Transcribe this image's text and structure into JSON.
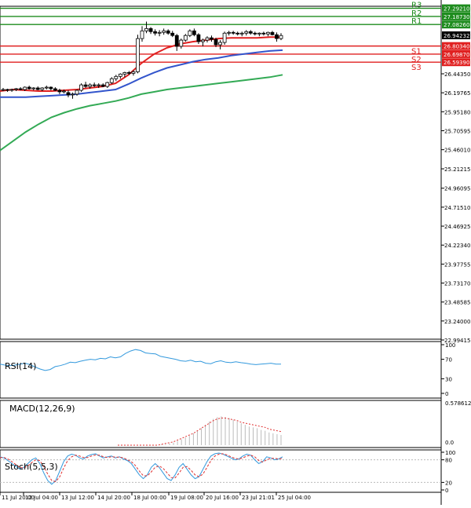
{
  "chart_data": [
    {
      "type": "candlestick",
      "panel": "price",
      "ylim": [
        22.99415,
        27.4
      ],
      "price_ticks": [
        "26.44350",
        "26.19765",
        "25.95180",
        "25.70595",
        "25.46010",
        "25.21215",
        "24.96095",
        "24.71510",
        "24.46925",
        "24.22340",
        "23.97755",
        "23.73170",
        "23.48585",
        "23.24000",
        "22.99415"
      ],
      "levels": [
        {
          "name": "R3",
          "value": 27.2921,
          "label": "27.29210",
          "color": "#1e8c1e"
        },
        {
          "name": "R2",
          "value": 27.1873,
          "label": "27.18730",
          "color": "#1e8c1e"
        },
        {
          "name": "R1",
          "value": 27.0826,
          "label": "27.08260",
          "color": "#1e8c1e"
        },
        {
          "name": "S1",
          "value": 26.8034,
          "label": "26.80340",
          "color": "#e02020"
        },
        {
          "name": "S2",
          "value": 26.6987,
          "label": "26.69870",
          "color": "#e02020"
        },
        {
          "name": "S3",
          "value": 26.5939,
          "label": "26.59390",
          "color": "#e02020"
        }
      ],
      "current_price": {
        "value": 26.94232,
        "label": "26.94232"
      },
      "candles": [
        [
          26.24,
          26.26,
          26.22,
          26.24
        ],
        [
          26.24,
          26.25,
          26.21,
          26.23
        ],
        [
          26.23,
          26.25,
          26.21,
          26.24
        ],
        [
          26.24,
          26.26,
          26.22,
          26.25
        ],
        [
          26.25,
          26.27,
          26.23,
          26.24
        ],
        [
          26.24,
          26.28,
          26.22,
          26.27
        ],
        [
          26.27,
          26.29,
          26.24,
          26.25
        ],
        [
          26.25,
          26.27,
          26.23,
          26.26
        ],
        [
          26.26,
          26.28,
          26.23,
          26.24
        ],
        [
          26.24,
          26.27,
          26.22,
          26.26
        ],
        [
          26.26,
          26.29,
          26.24,
          26.27
        ],
        [
          26.27,
          26.28,
          26.23,
          26.25
        ],
        [
          26.25,
          26.27,
          26.22,
          26.23
        ],
        [
          26.23,
          26.25,
          26.18,
          26.21
        ],
        [
          26.21,
          26.24,
          26.19,
          26.22
        ],
        [
          26.2,
          26.23,
          26.14,
          26.17
        ],
        [
          26.17,
          26.2,
          26.12,
          26.18
        ],
        [
          26.18,
          26.24,
          26.16,
          26.23
        ],
        [
          26.23,
          26.32,
          26.21,
          26.3
        ],
        [
          26.3,
          26.34,
          26.26,
          26.28
        ],
        [
          26.28,
          26.32,
          26.25,
          26.3
        ],
        [
          26.3,
          26.33,
          26.27,
          26.29
        ],
        [
          26.29,
          26.32,
          26.26,
          26.3
        ],
        [
          26.3,
          26.32,
          26.27,
          26.28
        ],
        [
          26.28,
          26.34,
          26.26,
          26.33
        ],
        [
          26.33,
          26.4,
          26.31,
          26.38
        ],
        [
          26.38,
          26.43,
          26.35,
          26.41
        ],
        [
          26.41,
          26.45,
          26.38,
          26.44
        ],
        [
          26.44,
          26.47,
          26.4,
          26.46
        ],
        [
          26.46,
          26.48,
          26.43,
          26.45
        ],
        [
          26.45,
          26.49,
          26.42,
          26.47
        ],
        [
          26.47,
          26.95,
          26.45,
          26.9
        ],
        [
          26.9,
          27.06,
          26.86,
          27.0
        ],
        [
          27.0,
          27.12,
          26.97,
          27.03
        ],
        [
          27.03,
          27.05,
          26.96,
          26.99
        ],
        [
          26.99,
          27.02,
          26.94,
          26.97
        ],
        [
          26.97,
          27.01,
          26.93,
          26.98
        ],
        [
          26.98,
          27.03,
          26.95,
          27.0
        ],
        [
          27.0,
          27.02,
          26.95,
          26.97
        ],
        [
          26.97,
          27.0,
          26.92,
          26.94
        ],
        [
          26.94,
          26.96,
          26.74,
          26.8
        ],
        [
          26.8,
          26.9,
          26.77,
          26.88
        ],
        [
          26.88,
          26.96,
          26.86,
          26.94
        ],
        [
          26.94,
          27.02,
          26.92,
          27.0
        ],
        [
          27.0,
          27.03,
          26.93,
          26.95
        ],
        [
          26.95,
          26.97,
          26.83,
          26.86
        ],
        [
          26.86,
          26.9,
          26.8,
          26.88
        ],
        [
          26.88,
          26.93,
          26.85,
          26.91
        ],
        [
          26.91,
          26.94,
          26.86,
          26.89
        ],
        [
          26.89,
          26.91,
          26.79,
          26.82
        ],
        [
          26.82,
          26.88,
          26.76,
          26.85
        ],
        [
          26.85,
          26.99,
          26.82,
          26.97
        ],
        [
          26.97,
          27.0,
          26.94,
          26.98
        ],
        [
          26.98,
          27.0,
          26.95,
          26.97
        ],
        [
          26.97,
          26.99,
          26.94,
          26.96
        ],
        [
          26.96,
          26.99,
          26.93,
          26.97
        ],
        [
          26.97,
          27.01,
          26.94,
          26.99
        ],
        [
          26.99,
          27.01,
          26.95,
          26.97
        ],
        [
          26.97,
          26.99,
          26.94,
          26.96
        ],
        [
          26.96,
          26.98,
          26.93,
          26.97
        ],
        [
          26.97,
          26.99,
          26.94,
          26.96
        ],
        [
          26.96,
          26.99,
          26.93,
          26.98
        ],
        [
          26.98,
          27.0,
          26.94,
          26.95
        ],
        [
          26.95,
          26.98,
          26.86,
          26.9
        ],
        [
          26.9,
          26.97,
          26.88,
          26.94
        ]
      ],
      "moving_averages": [
        {
          "color": "#e02020",
          "values": [
            26.22,
            26.24,
            26.23,
            26.22,
            26.22,
            26.23,
            26.24,
            26.26,
            26.28,
            26.32,
            26.43,
            26.58,
            26.7,
            26.78,
            26.83,
            26.86,
            26.88,
            26.9,
            26.91,
            26.91,
            26.91,
            26.92,
            26.92
          ]
        },
        {
          "color": "#3355cc",
          "values": [
            26.14,
            26.14,
            26.14,
            26.15,
            26.16,
            26.17,
            26.18,
            26.2,
            26.22,
            26.24,
            26.31,
            26.39,
            26.46,
            26.52,
            26.56,
            26.6,
            26.63,
            26.65,
            26.68,
            26.7,
            26.72,
            26.74,
            26.75
          ]
        },
        {
          "color": "#33aa55",
          "values": [
            25.45,
            25.57,
            25.69,
            25.79,
            25.88,
            25.94,
            25.99,
            26.03,
            26.06,
            26.09,
            26.13,
            26.18,
            26.21,
            26.24,
            26.26,
            26.28,
            26.3,
            26.32,
            26.34,
            26.36,
            26.38,
            26.4,
            26.43
          ]
        }
      ]
    },
    {
      "type": "line",
      "panel": "rsi",
      "title": "RSI(14)",
      "ylim": [
        0,
        100
      ],
      "yticks": [
        "100",
        "70",
        "30",
        "0"
      ],
      "values": [
        60,
        58,
        57,
        58,
        60,
        62,
        59,
        54,
        50,
        47,
        49,
        55,
        57,
        60,
        64,
        63,
        66,
        68,
        70,
        69,
        72,
        71,
        75,
        73,
        75,
        82,
        87,
        90,
        88,
        83,
        82,
        81,
        76,
        74,
        72,
        70,
        67,
        66,
        68,
        65,
        66,
        62,
        61,
        65,
        67,
        64,
        63,
        65,
        63,
        62,
        60,
        59,
        60,
        61,
        62,
        60,
        60
      ]
    },
    {
      "type": "bar",
      "panel": "macd",
      "title": "MACD(12,26,9)",
      "yticks": [
        "0.578612",
        "0.0"
      ],
      "histogram": [
        0.0,
        0.0,
        0.0,
        0.0,
        0.0,
        0.0,
        0.0,
        0.0,
        0.0,
        0.0,
        0.0,
        0.01,
        0.01,
        0.02,
        0.03,
        0.05,
        0.07,
        0.09,
        0.11,
        0.14,
        0.17,
        0.2,
        0.24,
        0.28,
        0.31,
        0.33,
        0.34,
        0.33,
        0.32,
        0.3,
        0.28,
        0.26,
        0.24,
        0.22,
        0.21,
        0.2,
        0.18,
        0.17,
        0.15,
        0.14,
        0.13,
        0.12
      ],
      "signal": [
        0.0,
        0.0,
        0.0,
        0.0,
        0.0,
        0.0,
        0.0,
        0.0,
        0.0,
        0.0,
        0.0,
        0.01,
        0.02,
        0.03,
        0.04,
        0.06,
        0.08,
        0.1,
        0.12,
        0.14,
        0.17,
        0.2,
        0.23,
        0.26,
        0.29,
        0.31,
        0.32,
        0.32,
        0.31,
        0.3,
        0.29,
        0.27,
        0.26,
        0.25,
        0.24,
        0.23,
        0.22,
        0.21,
        0.19,
        0.18,
        0.17,
        0.16
      ]
    },
    {
      "type": "line",
      "panel": "stochastic",
      "title": "Stoch(5,5,3)",
      "ylim": [
        0,
        100
      ],
      "yticks": [
        "100",
        "80",
        "20",
        "0"
      ],
      "series": [
        {
          "color": "#3399dd",
          "values": [
            88,
            85,
            78,
            70,
            62,
            55,
            60,
            70,
            80,
            85,
            70,
            45,
            25,
            15,
            25,
            50,
            75,
            90,
            95,
            92,
            85,
            82,
            90,
            94,
            96,
            90,
            85,
            88,
            90,
            85,
            88,
            82,
            78,
            70,
            55,
            40,
            30,
            40,
            60,
            70,
            60,
            45,
            30,
            25,
            40,
            60,
            70,
            55,
            40,
            30,
            35,
            55,
            75,
            90,
            96,
            98,
            95,
            90,
            85,
            80,
            82,
            90,
            95,
            92,
            80,
            70,
            75,
            88,
            85,
            80,
            82,
            88
          ]
        },
        {
          "color": "#e03030",
          "values": [
            86,
            86,
            82,
            75,
            67,
            60,
            58,
            64,
            73,
            80,
            78,
            62,
            42,
            25,
            22,
            35,
            58,
            78,
            88,
            92,
            90,
            86,
            86,
            90,
            93,
            92,
            88,
            86,
            88,
            87,
            87,
            85,
            80,
            75,
            65,
            50,
            38,
            37,
            48,
            60,
            64,
            57,
            45,
            33,
            32,
            45,
            60,
            62,
            52,
            40,
            35,
            42,
            60,
            78,
            90,
            95,
            96,
            93,
            88,
            84,
            82,
            85,
            90,
            92,
            88,
            78,
            74,
            80,
            84,
            84,
            82,
            84
          ]
        }
      ]
    },
    {
      "type": "axis",
      "panel": "time",
      "xticks": [
        "11 Jul 20:00",
        "12 Jul 04:00",
        "13 Jul 12:00",
        "14 Jul 20:00",
        "18 Jul 00:00",
        "19 Jul 08:00",
        "20 Jul 16:00",
        "23 Jul 21:01",
        "25 Jul 04:00"
      ]
    }
  ]
}
